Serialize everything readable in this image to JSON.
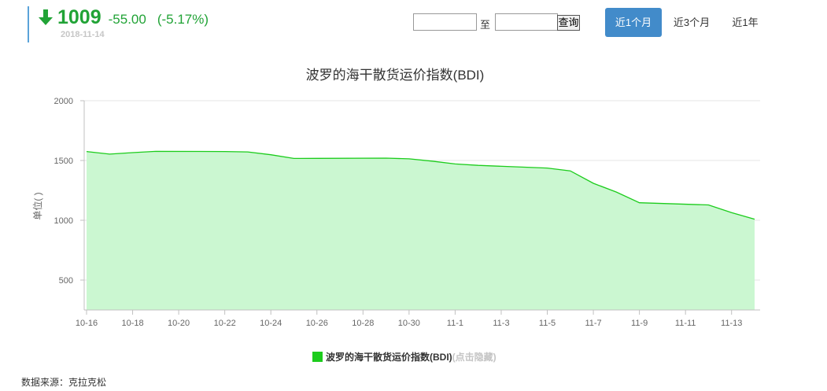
{
  "quote": {
    "price": "1009",
    "change": "-55.00",
    "change_pct": "(-5.17%)",
    "date": "2018-11-14",
    "trend_icon": "arrow-down-icon",
    "color": "#21a336"
  },
  "range": {
    "start_value": "",
    "end_value": "",
    "separator": "至",
    "query_label": "查询"
  },
  "tabs": [
    {
      "label": "近1个月",
      "active": true
    },
    {
      "label": "近3个月",
      "active": false
    },
    {
      "label": "近1年",
      "active": false
    }
  ],
  "chart_data": {
    "type": "area",
    "title": "波罗的海干散货运价指数(BDI)",
    "ylabel": "单位( )",
    "xlabel": "",
    "ylim": [
      250,
      2000
    ],
    "yticks": [
      500,
      1000,
      1500,
      2000
    ],
    "xlim": [
      "2018-10-16",
      "2018-11-14"
    ],
    "xtick_labels": [
      "10-16",
      "10-18",
      "10-20",
      "10-22",
      "10-24",
      "10-26",
      "10-28",
      "10-30",
      "11-1",
      "11-3",
      "11-5",
      "11-7",
      "11-9",
      "11-11",
      "11-13"
    ],
    "grid": true,
    "legend": "bottom-center",
    "series": [
      {
        "name": "波罗的海干散货运价指数(BDI)",
        "color": "#1ccc1c",
        "fill": "#cbf7d1",
        "x": [
          "2018-10-16",
          "2018-10-17",
          "2018-10-18",
          "2018-10-19",
          "2018-10-22",
          "2018-10-23",
          "2018-10-24",
          "2018-10-25",
          "2018-10-26",
          "2018-10-29",
          "2018-10-30",
          "2018-10-31",
          "2018-11-01",
          "2018-11-02",
          "2018-11-05",
          "2018-11-06",
          "2018-11-07",
          "2018-11-08",
          "2018-11-09",
          "2018-11-12",
          "2018-11-13",
          "2018-11-14"
        ],
        "y": [
          1575,
          1553,
          1566,
          1576,
          1575,
          1572,
          1548,
          1517,
          1518,
          1520,
          1514,
          1495,
          1471,
          1459,
          1437,
          1413,
          1309,
          1236,
          1147,
          1128,
          1064,
          1009
        ]
      }
    ],
    "legend_hint": "(点击隐藏)"
  },
  "footer": {
    "source": "数据来源：克拉克松"
  }
}
